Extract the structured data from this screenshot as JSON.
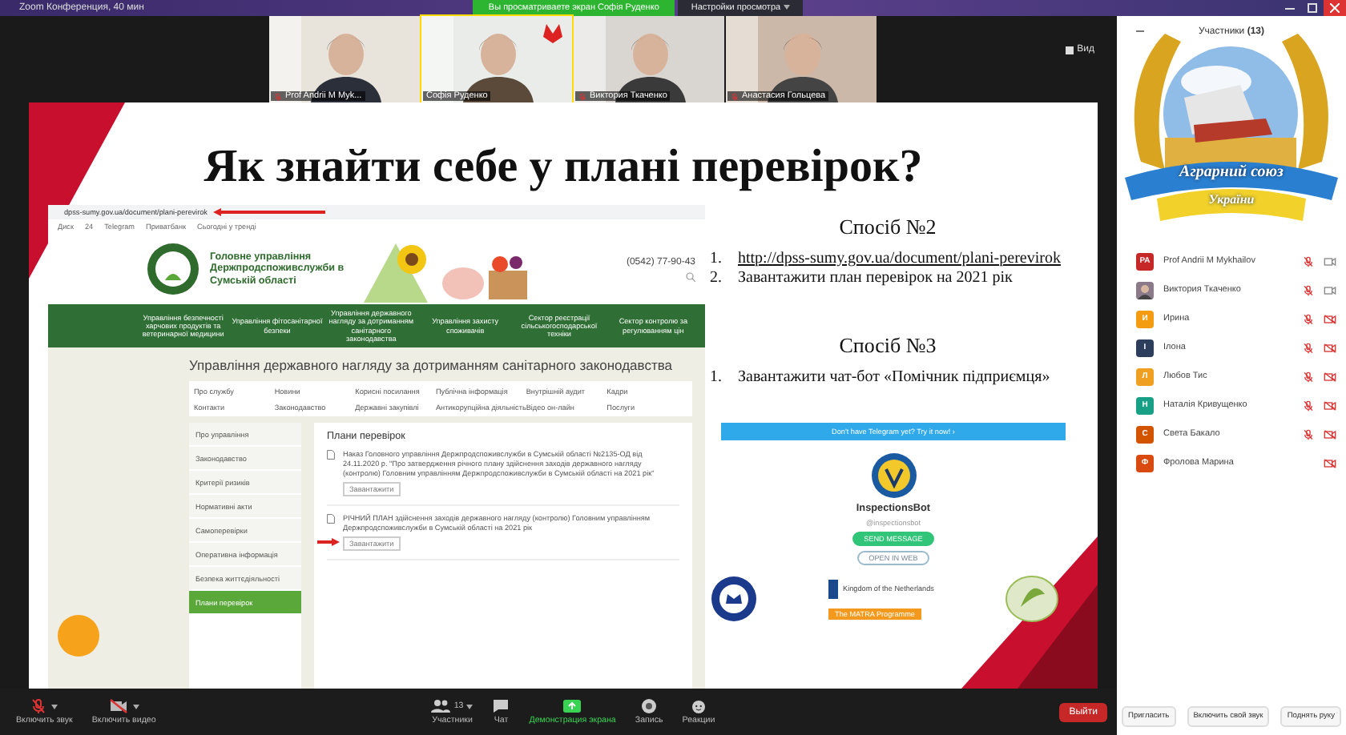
{
  "window": {
    "title": "Zoom Конференция, 40 мин",
    "share_banner": "Вы просматриваете экран Софія Руденко",
    "view_options": "Настройки просмотра",
    "view_button": "Вид"
  },
  "videos": [
    {
      "name": "Prof Andrii M Myk...",
      "muted": true,
      "selected": false
    },
    {
      "name": "Софія Руденко",
      "muted": false,
      "selected": true
    },
    {
      "name": "Виктория Ткаченко",
      "muted": true,
      "selected": false
    },
    {
      "name": "Анастасия Гольцева",
      "muted": true,
      "selected": false
    }
  ],
  "slide": {
    "title": "Як знайти себе у плані перевірок?",
    "website": {
      "url": "dpss-sumy.gov.ua/document/plani-perevirok",
      "bookmarks": [
        "Диск",
        "24",
        "Telegram",
        "Приватбанк",
        "Сьогодні у тренді"
      ],
      "org_name": "Головне управління Держпродспоживслужби в Сумській області",
      "phone": "(0542) 77-90-43",
      "nav": [
        "Управління безпечності харчових продуктів та ветеринарної медицини",
        "Управління фітосанітарної безпеки",
        "Управління державного нагляду за дотриманням санітарного законодавства",
        "Управління захисту споживачів",
        "Сектор реєстрації сільськогосподарської техніки",
        "Сектор контролю за регулюванням цін"
      ],
      "page_title": "Управління державного нагляду за дотриманням санітарного законодавства",
      "menu": [
        "Про службу",
        "Новини",
        "Корисні посилання",
        "Публічна інформація",
        "Внутрішній аудит",
        "Кадри",
        "Контакти",
        "Законодавство",
        "Державні закупівлі",
        "Антикорупційна діяльність",
        "Відео он-лайн",
        "Послуги"
      ],
      "sidebar": [
        {
          "label": "Про управління",
          "selected": false
        },
        {
          "label": "Законодавство",
          "selected": false
        },
        {
          "label": "Критерії ризиків",
          "selected": false
        },
        {
          "label": "Нормативні акти",
          "selected": false
        },
        {
          "label": "Самоперевірки",
          "selected": false
        },
        {
          "label": "Оперативна інформація",
          "selected": false
        },
        {
          "label": "Безпека життєдіяльності",
          "selected": false
        },
        {
          "label": "Плани перевірок",
          "selected": true
        }
      ],
      "section_title": "Плани перевірок",
      "documents": [
        {
          "text": "Наказ Головного управління Держпродспоживслужби в Сумській області №2135-ОД від 24.11.2020 р. \"Про затвердження річного плану здійснення заходів державного нагляду (контролю) Головним управлінням Держпродспоживслужби в Сумській області на 2021 рік\"",
          "button": "Завантажити",
          "arrow": false
        },
        {
          "text": "РІЧНИЙ ПЛАН здійснення заходів державного нагляду (контролю) Головним управлінням Держпродспоживслужби в Сумській області на 2021 рік",
          "button": "Завантажити",
          "arrow": true
        }
      ]
    },
    "methods": [
      {
        "heading": "Спосіб №2",
        "items": [
          {
            "number": "1.",
            "text": "http://dpss-sumy.gov.ua/document/plani-perevirok",
            "kind": "link"
          },
          {
            "number": "2.",
            "text": "Завантажити план перевірок на 2021 рік",
            "kind": "text"
          }
        ]
      },
      {
        "heading": "Спосіб №3",
        "items": [
          {
            "number": "1.",
            "text": "Завантажити чат-бот «Помічник підприємця»",
            "kind": "text"
          }
        ]
      }
    ],
    "telegram": {
      "banner": "Don't have Telegram yet? Try it now! ›",
      "bot_name": "InspectionsBot",
      "handle": "@inspectionsbot",
      "send": "SEND MESSAGE",
      "open": "OPEN IN WEB"
    },
    "partners": {
      "netherlands": "Kingdom of the Netherlands",
      "matra": "The MATRA Programme"
    }
  },
  "participants": {
    "title": "Участники",
    "count": "(13)",
    "logo_lines": [
      "Аграрний союз",
      "України"
    ],
    "list": [
      {
        "initials": "PA",
        "name": "Prof Andrii M Mykhailov",
        "color": "#c62828",
        "kind": "initials",
        "muted": true,
        "video_off": false
      },
      {
        "name": "Виктория Ткаченко",
        "muted": true,
        "video_off": false
      },
      {
        "initials": "И",
        "name": "Ирина",
        "color": "#f39c12",
        "kind": "initials",
        "muted": true,
        "video_off": true
      },
      {
        "initials": "І",
        "name": "Ілона",
        "color": "#2c3e5c",
        "kind": "initials",
        "muted": true,
        "video_off": true
      },
      {
        "initials": "Л",
        "name": "Любов Тис",
        "color": "#f0a020",
        "kind": "initials",
        "muted": true,
        "video_off": true
      },
      {
        "initials": "Н",
        "name": "Наталія Кривущенко",
        "color": "#17a085",
        "kind": "initials",
        "muted": true,
        "video_off": true
      },
      {
        "initials": "С",
        "name": "Света Бакало",
        "color": "#d35400",
        "kind": "initials",
        "muted": true,
        "video_off": true
      },
      {
        "initials": "Ф",
        "name": "Фролова Марина",
        "color": "#d84a10",
        "kind": "initials",
        "muted": false,
        "video_off": true
      }
    ],
    "buttons": [
      "Пригласить",
      "Включить свой звук",
      "Поднять руку"
    ]
  },
  "toolbar": {
    "left": [
      {
        "label": "Включить звук",
        "kind": "mic"
      },
      {
        "label": "Включить видео",
        "kind": "video"
      }
    ],
    "center": [
      {
        "label": "Участники",
        "kind": "people",
        "count": "13",
        "selected": false
      },
      {
        "label": "Чат",
        "kind": "chat",
        "selected": false
      },
      {
        "label": "Демонстрация экрана",
        "kind": "share",
        "selected": true
      },
      {
        "label": "Запись",
        "kind": "record",
        "selected": false
      },
      {
        "label": "Реакции",
        "kind": "reaction",
        "selected": false
      }
    ],
    "leave": "Выйти"
  }
}
